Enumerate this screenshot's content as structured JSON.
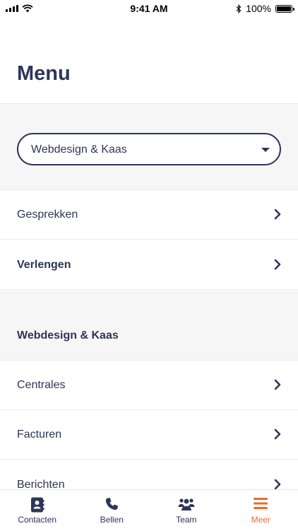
{
  "status_bar": {
    "time": "9:41 AM",
    "battery": "100%"
  },
  "page": {
    "title": "Menu"
  },
  "account_select": {
    "value": "Webdesign & Kaas"
  },
  "menu_items": [
    {
      "label": "Gesprekken",
      "bold": false
    },
    {
      "label": "Verlengen",
      "bold": true
    }
  ],
  "section": {
    "header": "Webdesign & Kaas",
    "items": [
      {
        "label": "Centrales"
      },
      {
        "label": "Facturen"
      },
      {
        "label": "Berichten"
      }
    ]
  },
  "tab_bar": {
    "tabs": [
      {
        "label": "Contacten",
        "icon": "contacts-icon"
      },
      {
        "label": "Bellen",
        "icon": "phone-icon"
      },
      {
        "label": "Team",
        "icon": "team-icon"
      },
      {
        "label": "Meer",
        "icon": "menu-icon",
        "active": true
      }
    ]
  },
  "colors": {
    "primary": "#2e3558",
    "accent": "#ee6a2c",
    "band": "#f6f6f6"
  }
}
